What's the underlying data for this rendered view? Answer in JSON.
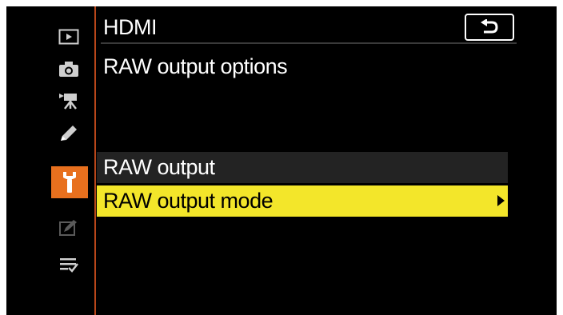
{
  "header": {
    "title": "HDMI",
    "subtitle": "RAW output options"
  },
  "sidebar": {
    "items": [
      {
        "icon": "playback-icon"
      },
      {
        "icon": "camera-icon"
      },
      {
        "icon": "movie-camera-icon"
      },
      {
        "icon": "pencil-icon"
      },
      {
        "icon": "wrench-icon",
        "active": true
      },
      {
        "icon": "retouch-icon"
      },
      {
        "icon": "my-menu-icon"
      }
    ],
    "active_color": "#e8701e"
  },
  "menu": {
    "items": [
      {
        "label": "RAW output",
        "state": "dim"
      },
      {
        "label": "RAW output mode",
        "state": "selected",
        "has_submenu": true
      }
    ],
    "highlight_color": "#f3e62a"
  },
  "back_button": {
    "icon": "back-arrow-icon"
  }
}
